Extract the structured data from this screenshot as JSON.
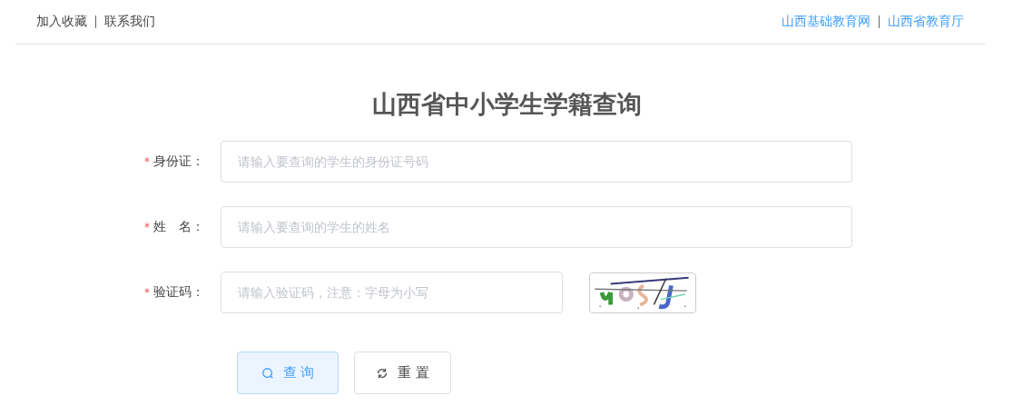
{
  "header": {
    "left_links": [
      "加入收藏",
      "联系我们"
    ],
    "right_links": [
      "山西基础教育网",
      "山西省教育厅"
    ]
  },
  "title": "山西省中小学生学籍查询",
  "fields": [
    {
      "label": "身份证：",
      "required": true,
      "placeholder": "请输入要查询的学生的身份证号码",
      "kind": "text"
    },
    {
      "label": "姓　名：",
      "required": true,
      "placeholder": "请输入要查询的学生的姓名",
      "kind": "text"
    },
    {
      "label": "验证码：",
      "required": true,
      "placeholder": "请输入验证码，注意：字母为小写",
      "kind": "captcha"
    }
  ],
  "buttons": [
    {
      "label": "查 询",
      "kind": "primary"
    },
    {
      "label": "重 置",
      "kind": "reset"
    }
  ]
}
